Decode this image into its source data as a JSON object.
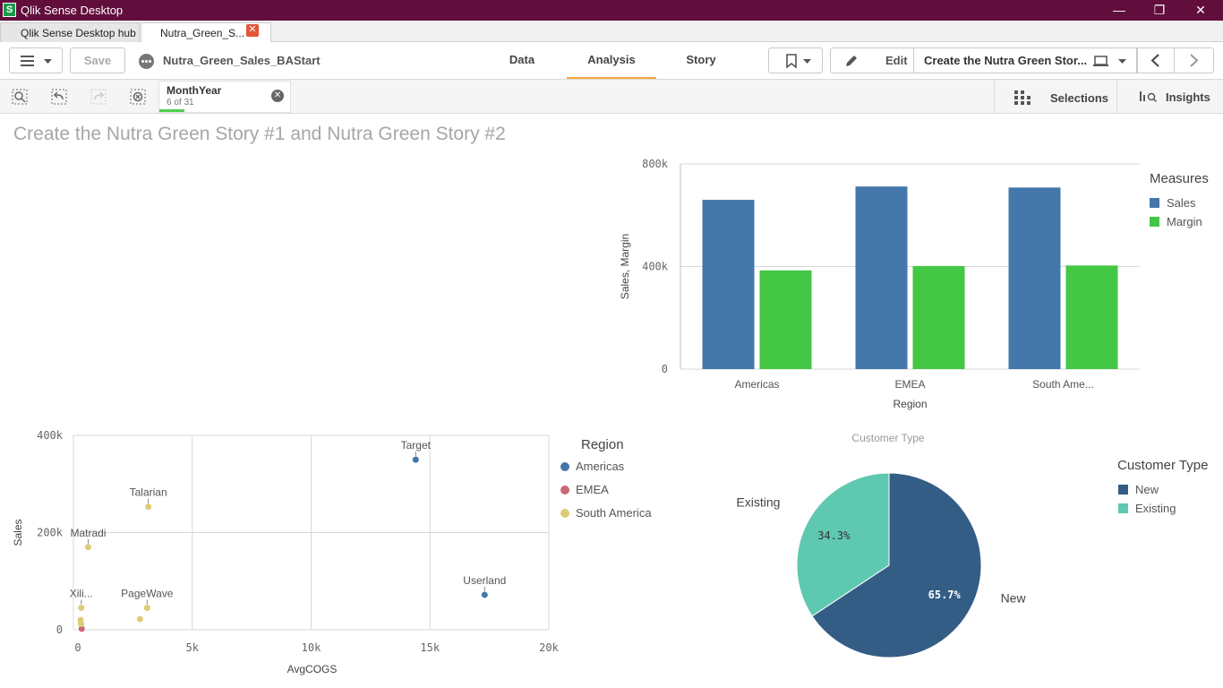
{
  "window": {
    "title": "Qlik Sense Desktop",
    "app_icon_letter": "S",
    "minimize": "—",
    "restore": "❐",
    "close": "✕"
  },
  "tabs": [
    {
      "label": "Qlik Sense Desktop hub"
    },
    {
      "label": "Nutra_Green_S...",
      "close": "✕"
    }
  ],
  "toolbar": {
    "save_label": "Save",
    "app_name": "Nutra_Green_Sales_BAStart",
    "nav": [
      "Data",
      "Analysis",
      "Story"
    ],
    "edit_label": "Edit",
    "sheet_name": "Create the Nutra Green Stor..."
  },
  "selections_bar": {
    "field": "MonthYear",
    "count": "6 of 31",
    "selections_label": "Selections",
    "insights_label": "Insights"
  },
  "sheet": {
    "title": "Create the Nutra Green Story #1 and Nutra Green Story #2"
  },
  "colors": {
    "sales": "#4477aa",
    "margin": "#44c744",
    "americas": "#4477aa",
    "emea": "#cc6677",
    "south_america": "#ddcc77",
    "new": "#335d85",
    "existing": "#5ec9b0",
    "title_bar": "#620e3c",
    "active_tab": "#f8a53c"
  },
  "chart_data": [
    {
      "type": "bar",
      "categories": [
        "Americas",
        "EMEA",
        "South Ame..."
      ],
      "series": [
        {
          "name": "Sales",
          "values": [
            660000,
            712000,
            708000
          ]
        },
        {
          "name": "Margin",
          "values": [
            385000,
            402000,
            404000
          ]
        }
      ],
      "xlabel": "Region",
      "ylabel": "Sales, Margin",
      "legend_title": "Measures",
      "legend_position": "right",
      "ylim": [
        0,
        800000
      ],
      "yticks": [
        "800k",
        "400k",
        "0"
      ],
      "grid": true
    },
    {
      "type": "scatter",
      "xlabel": "AvgCOGS",
      "ylabel": "Sales",
      "legend_title": "Region",
      "legend_position": "right",
      "xlim": [
        0,
        20000
      ],
      "ylim": [
        0,
        400000
      ],
      "xticks": [
        "0",
        "5k",
        "10k",
        "15k",
        "20k"
      ],
      "yticks": [
        "400k",
        "200k",
        "0"
      ],
      "grid": true,
      "series": [
        {
          "name": "Americas",
          "points": [
            {
              "label": "Target",
              "x": 14400,
              "y": 350000
            },
            {
              "label": "Userland",
              "x": 17300,
              "y": 72000
            }
          ]
        },
        {
          "name": "EMEA",
          "points": [
            {
              "label": "",
              "x": 350,
              "y": 2000
            }
          ]
        },
        {
          "name": "South America",
          "points": [
            {
              "label": "Talarian",
              "x": 3150,
              "y": 253000
            },
            {
              "label": "Matradi",
              "x": 620,
              "y": 170000
            },
            {
              "label": "Xili...",
              "x": 330,
              "y": 45000
            },
            {
              "label": "PageWave",
              "x": 3100,
              "y": 45000
            },
            {
              "label": "",
              "x": 2800,
              "y": 22000
            },
            {
              "label": "",
              "x": 300,
              "y": 20000
            },
            {
              "label": "",
              "x": 320,
              "y": 12000
            }
          ]
        }
      ]
    },
    {
      "type": "pie",
      "title": "Customer Type",
      "legend_title": "Customer Type",
      "legend_position": "right",
      "slices": [
        {
          "name": "New",
          "value": 65.7,
          "label": "65.7%"
        },
        {
          "name": "Existing",
          "value": 34.3,
          "label": "34.3%"
        }
      ]
    }
  ]
}
